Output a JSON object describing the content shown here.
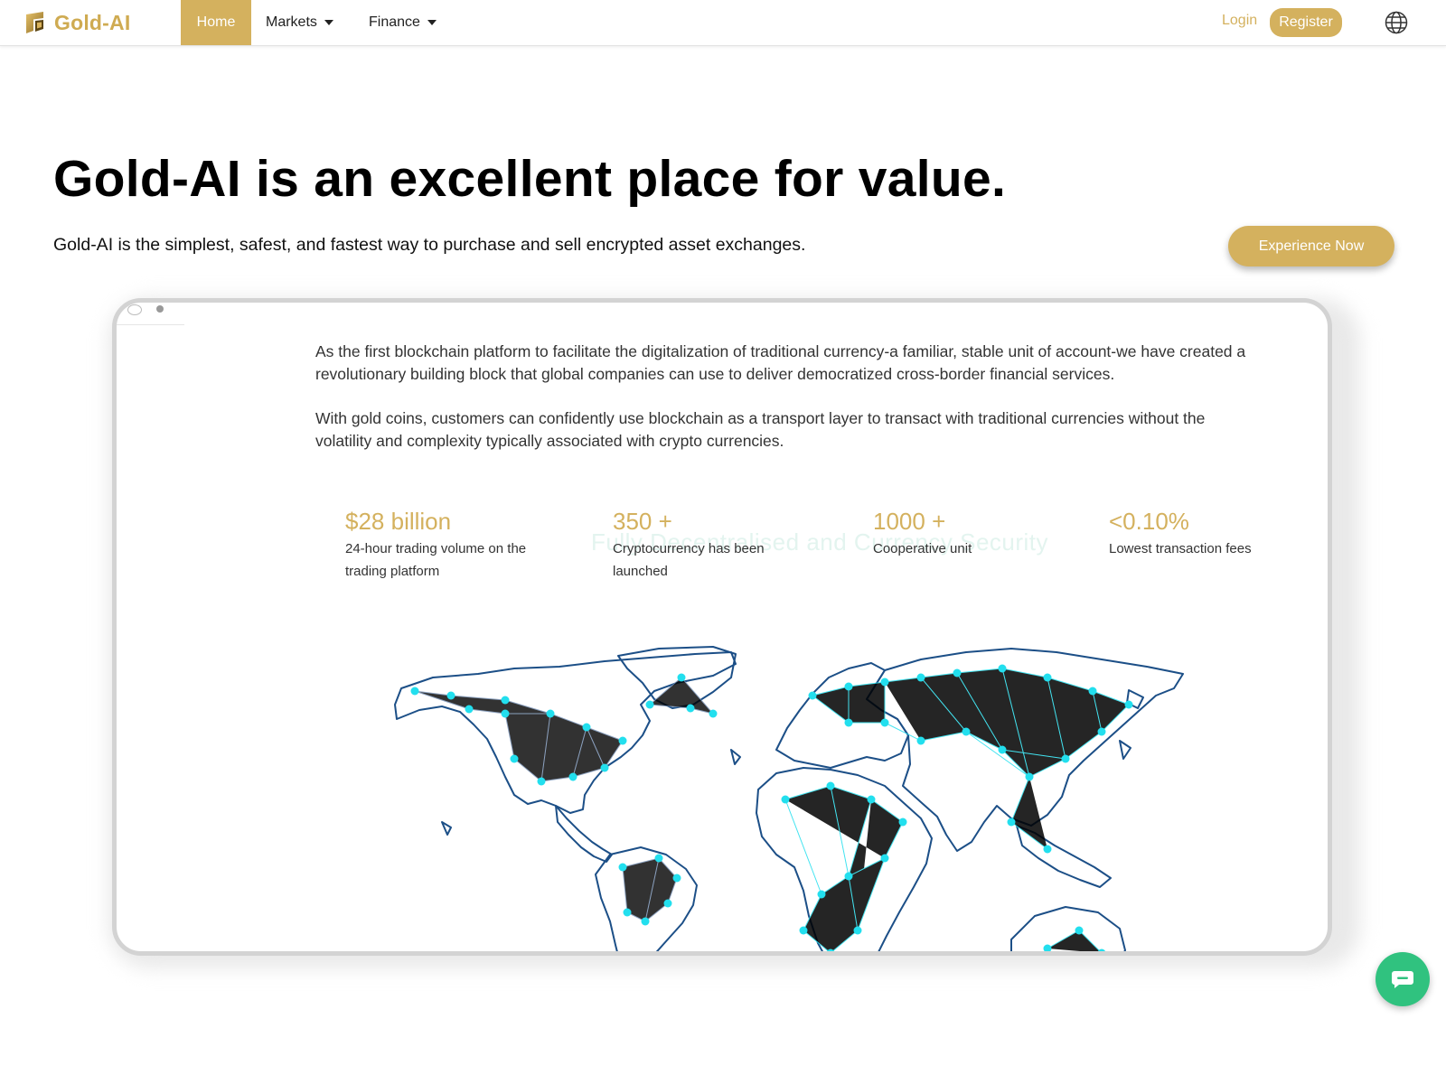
{
  "nav": {
    "brand": "Gold-AI",
    "home": "Home",
    "markets": "Markets",
    "finance": "Finance",
    "login": "Login",
    "register": "Register",
    "language_icon": "globe-icon"
  },
  "hero": {
    "title": "Gold-AI is an excellent place for value.",
    "subtitle": "Gold-AI is the simplest, safest, and fastest way to purchase and sell encrypted asset exchanges.",
    "cta": "Experience Now"
  },
  "device": {
    "paragraph1": "As the first blockchain platform to facilitate the digitalization of traditional currency-a familiar, stable unit of account-we have created a revolutionary building block that global companies can use to deliver democratized cross-border financial services.",
    "paragraph2": "With gold coins, customers can confidently use blockchain as a transport layer to transact with traditional currencies without the volatility and complexity typically associated with crypto currencies.",
    "ghost_text": "Fully Decentralised and Currency Security",
    "stats": [
      {
        "value": "$28 billion",
        "label": "24-hour trading volume on the trading platform"
      },
      {
        "value": "350 +",
        "label": "Cryptocurrency has been launched"
      },
      {
        "value": "1000 +",
        "label": "Cooperative unit"
      },
      {
        "value": "<0.10%",
        "label": "Lowest transaction fees"
      }
    ]
  },
  "colors": {
    "gold": "#d4b15e",
    "map_outline": "#1c4f87",
    "map_node": "#22dfee",
    "chat": "#30c27f"
  },
  "chat_icon": "chat-bubble-icon"
}
